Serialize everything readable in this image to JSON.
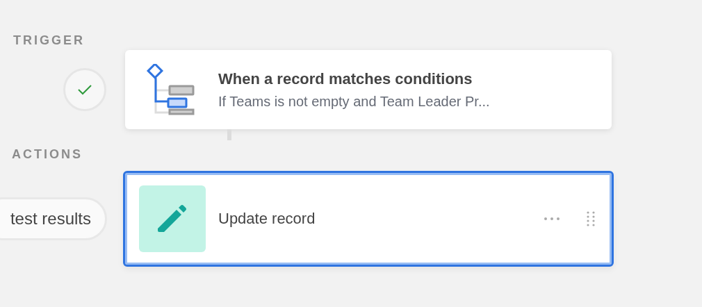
{
  "trigger": {
    "label": "TRIGGER",
    "completed": true,
    "card": {
      "kind": "condition",
      "title": "When a record matches conditions",
      "subtitle": "If Teams is not empty and Team Leader Pr...",
      "selected": false
    }
  },
  "actions": {
    "label": "ACTIONS",
    "test_button": "test results",
    "cards": [
      {
        "kind": "update",
        "title": "Update record",
        "selected": true
      }
    ]
  }
}
